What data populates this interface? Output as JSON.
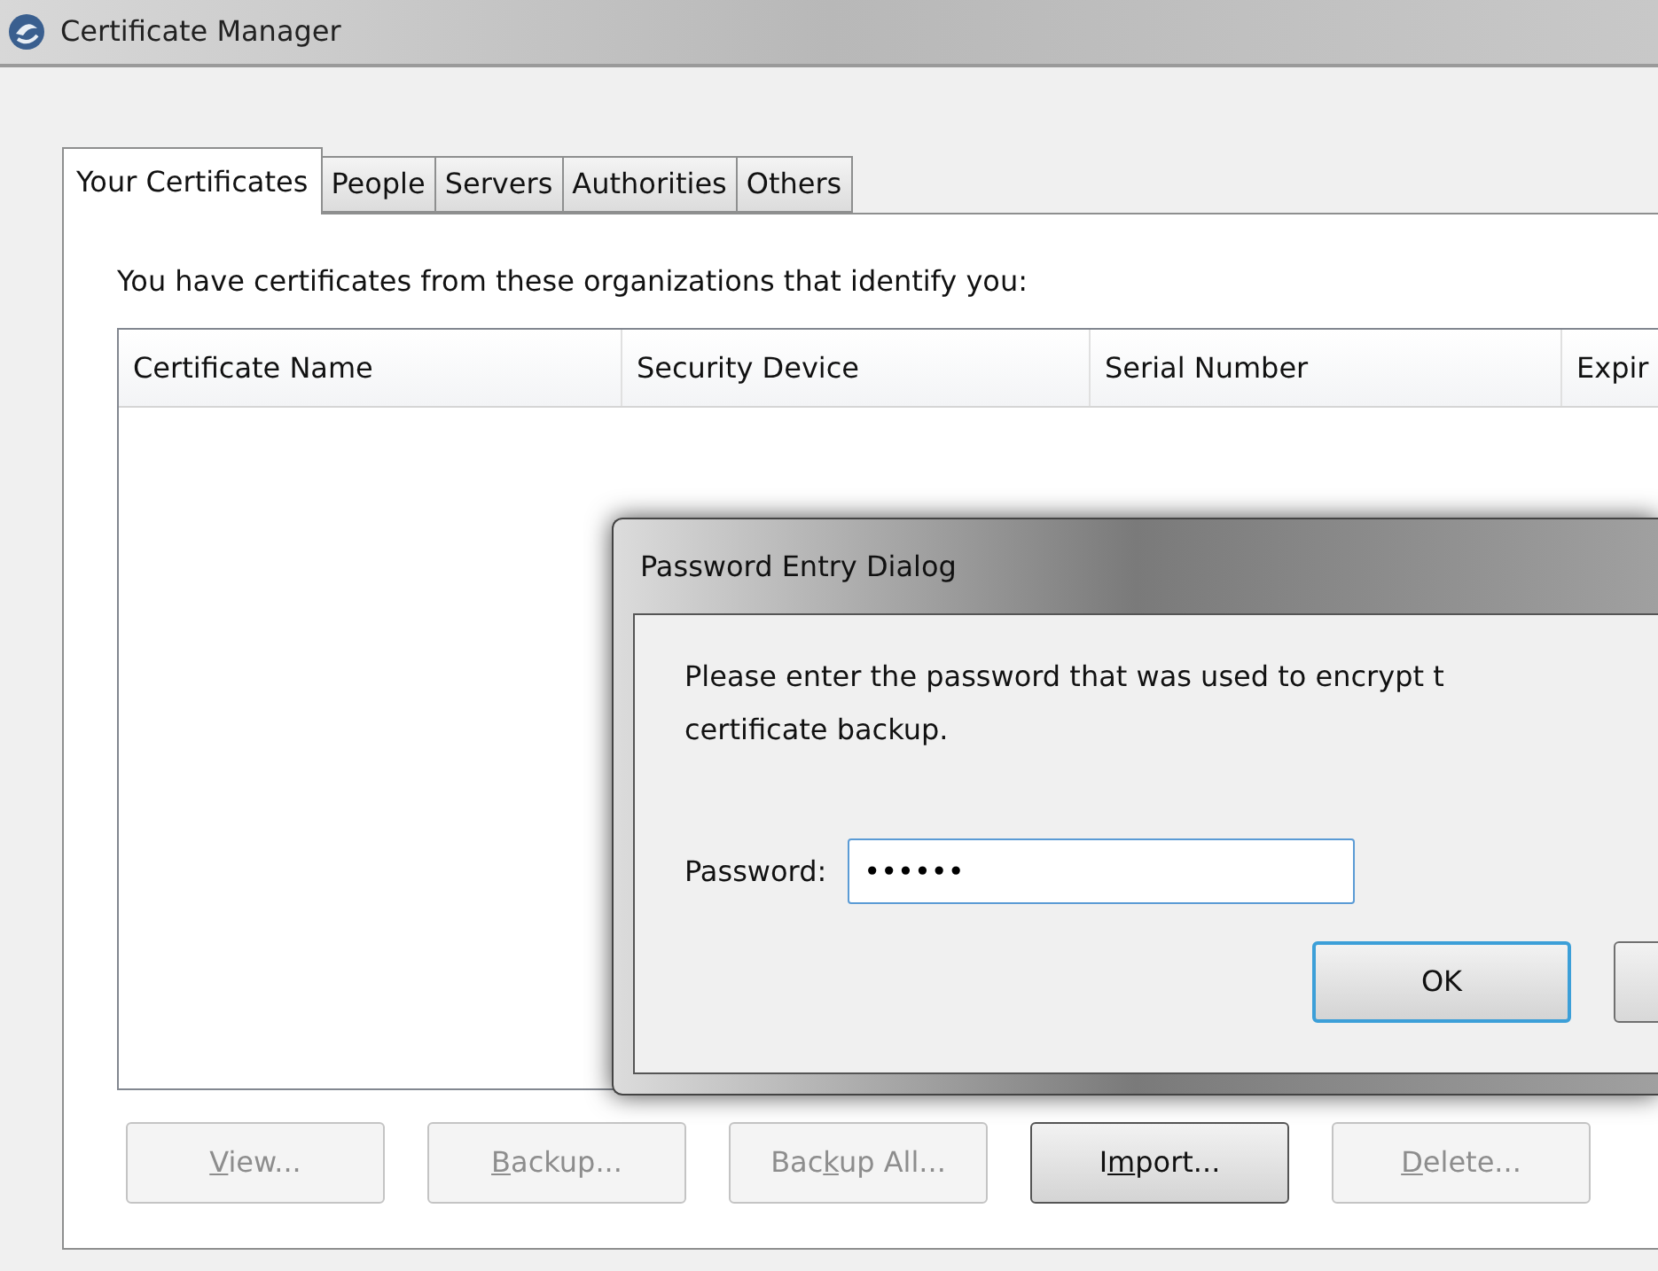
{
  "window": {
    "title": "Certificate Manager"
  },
  "tabs": [
    {
      "label": "Your Certificates",
      "selected": true
    },
    {
      "label": "People",
      "selected": false
    },
    {
      "label": "Servers",
      "selected": false
    },
    {
      "label": "Authorities",
      "selected": false
    },
    {
      "label": "Others",
      "selected": false
    }
  ],
  "intro": "You have certificates from these organizations that identify you:",
  "table": {
    "columns": [
      "Certificate Name",
      "Security Device",
      "Serial Number",
      "Expir"
    ]
  },
  "buttons": [
    {
      "access_key": "V",
      "after": "iew...",
      "disabled": true
    },
    {
      "access_key": "B",
      "after": "ackup...",
      "disabled": true
    },
    {
      "before": "Bac",
      "access_key": "k",
      "after": "up All...",
      "disabled": true
    },
    {
      "before": "I",
      "access_key": "m",
      "after": "port...",
      "disabled": false
    },
    {
      "access_key": "D",
      "after": "elete...",
      "disabled": true
    }
  ],
  "dialog": {
    "title": "Password Entry Dialog",
    "message": "Please enter the password that was used to encrypt t\ncertificate backup.",
    "field_label": "Password:",
    "field_value": "••••••",
    "buttons": [
      {
        "label": "OK",
        "default": true
      },
      {
        "default": false
      }
    ]
  }
}
